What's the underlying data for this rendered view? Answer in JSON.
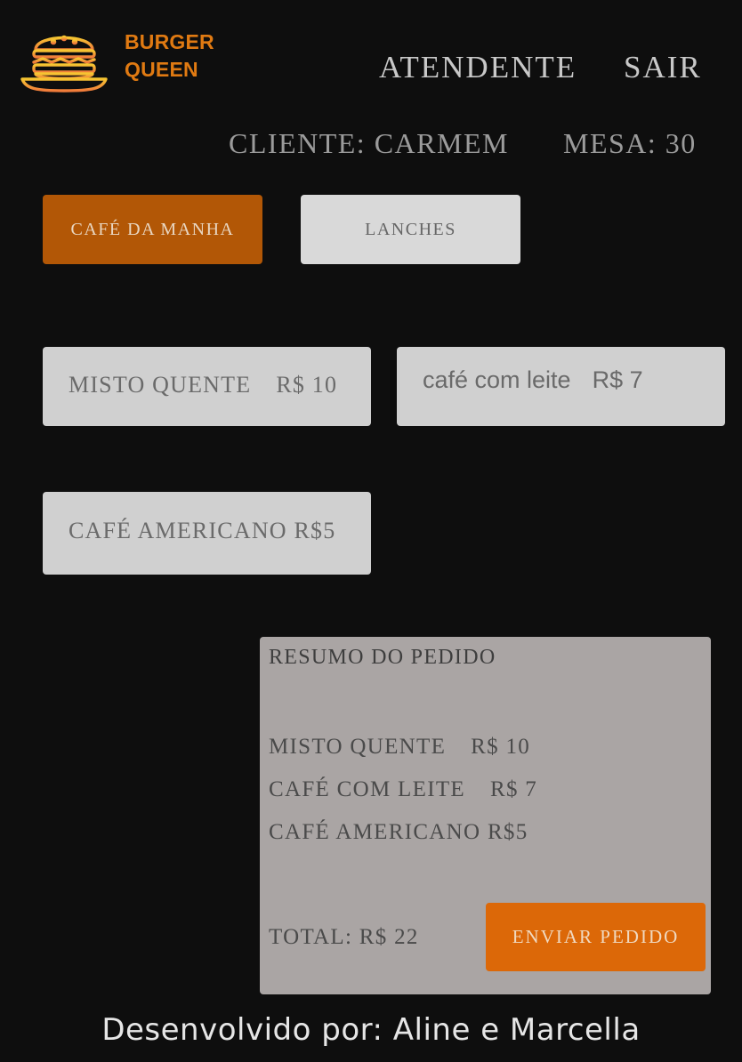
{
  "brand": {
    "line1": "BURGER",
    "line2": "QUEEN",
    "logo_icon": "burger-logo-icon",
    "colors": {
      "accent": "#e07a12",
      "gradient_top": "#f6c531",
      "gradient_bottom": "#f07b3a"
    }
  },
  "nav": {
    "attendant": "ATENDENTE",
    "exit": "SAIR"
  },
  "order": {
    "client": "CLIENTE: CARMEM",
    "table": "MESA: 30"
  },
  "tabs": {
    "breakfast": "CAFÉ DA MANHA",
    "snacks": "LANCHES",
    "active_color": "#b25706",
    "inactive_color": "#d9d9d9"
  },
  "menu": {
    "items": [
      {
        "name": "MISTO QUENTE",
        "price": "R$ 10"
      },
      {
        "name": "café com leite",
        "price": "R$ 7"
      },
      {
        "name": "CAFÉ AMERICANO",
        "price": "R$5"
      }
    ]
  },
  "summary": {
    "title": "RESUMO DO PEDIDO",
    "lines": [
      {
        "name": "MISTO QUENTE",
        "price": "R$ 10"
      },
      {
        "name": "CAFÉ COM LEITE",
        "price": "R$ 7"
      },
      {
        "name": "CAFÉ AMERICANO",
        "price": "R$5"
      }
    ],
    "total": "TOTAL: R$ 22",
    "send_label": "ENVIAR PEDIDO",
    "send_color": "#dc6808"
  },
  "footer": {
    "credit": "Desenvolvido por: Aline e Marcella"
  }
}
